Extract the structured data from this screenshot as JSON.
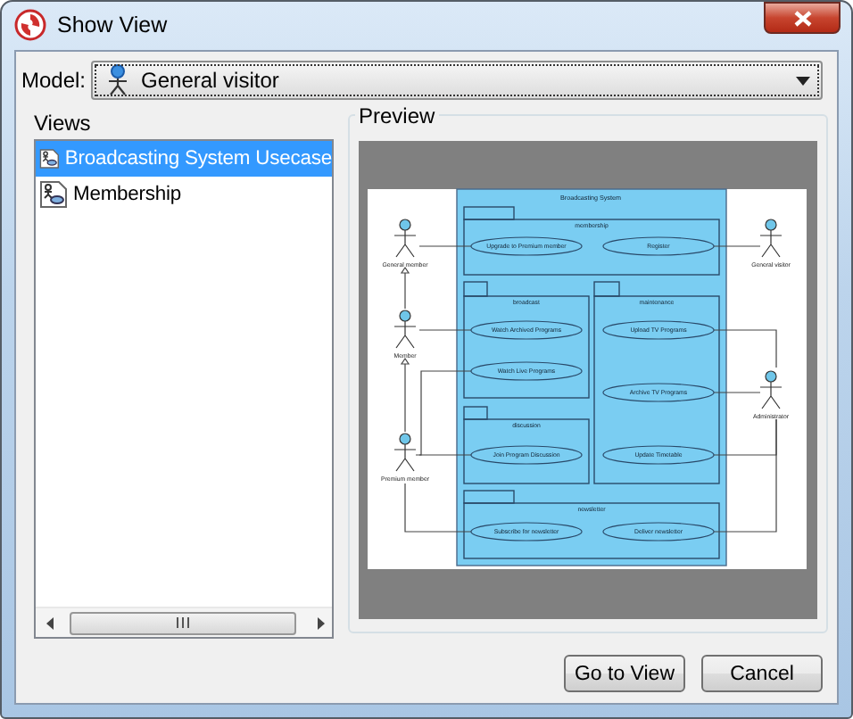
{
  "window": {
    "title": "Show View"
  },
  "model": {
    "label": "Model:",
    "value": "General visitor"
  },
  "views": {
    "label": "Views",
    "items": [
      {
        "label": "Broadcasting System Usecase",
        "selected": true
      },
      {
        "label": "Membership",
        "selected": false
      }
    ]
  },
  "preview": {
    "label": "Preview",
    "diagram": {
      "title": "Broadcasting System",
      "packages": [
        "membership",
        "broadcast",
        "maintenance",
        "discussion",
        "newsletter"
      ],
      "use_cases": [
        "Upgrade to Premium member",
        "Register",
        "Watch Archived Programs",
        "Upload TV Programs",
        "Watch Live Programs",
        "Archive TV Programs",
        "Join Program Discussion",
        "Update Timetable",
        "Subscribe for newsletter",
        "Deliver newsletter"
      ],
      "actors": [
        "General member",
        "General visitor",
        "Member",
        "Administrator",
        "Premium member"
      ]
    }
  },
  "buttons": [
    "Go to View",
    "Cancel"
  ]
}
